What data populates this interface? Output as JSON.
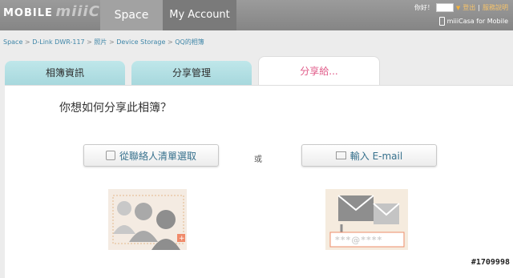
{
  "header": {
    "logo": "MOBILE",
    "logo_sub": "miiiCasa",
    "nav": [
      "Space",
      "My Account"
    ],
    "greeting": "你好！",
    "links": [
      "登出",
      "服務說明"
    ],
    "separator": "|",
    "mobile": "miiiCasa for Mobile"
  },
  "breadcrumb": {
    "items": [
      "Space",
      "D-Link DWR-117",
      "照片",
      "Device Storage",
      "QQ的相簿"
    ],
    "sep": " > "
  },
  "tabs": [
    "相簿資訊",
    "分享管理",
    "分享給..."
  ],
  "panel": {
    "question": "你想如何分享此相簿？",
    "contacts_button": "從聯絡人清單選取",
    "or": "或",
    "email_button": "輸入 E-mail",
    "email_mask": "***@****"
  },
  "watermark": "#1709998",
  "colors": {
    "accent": "#e05a88",
    "link": "#3f86a8",
    "tab": "#a7d8dd"
  }
}
